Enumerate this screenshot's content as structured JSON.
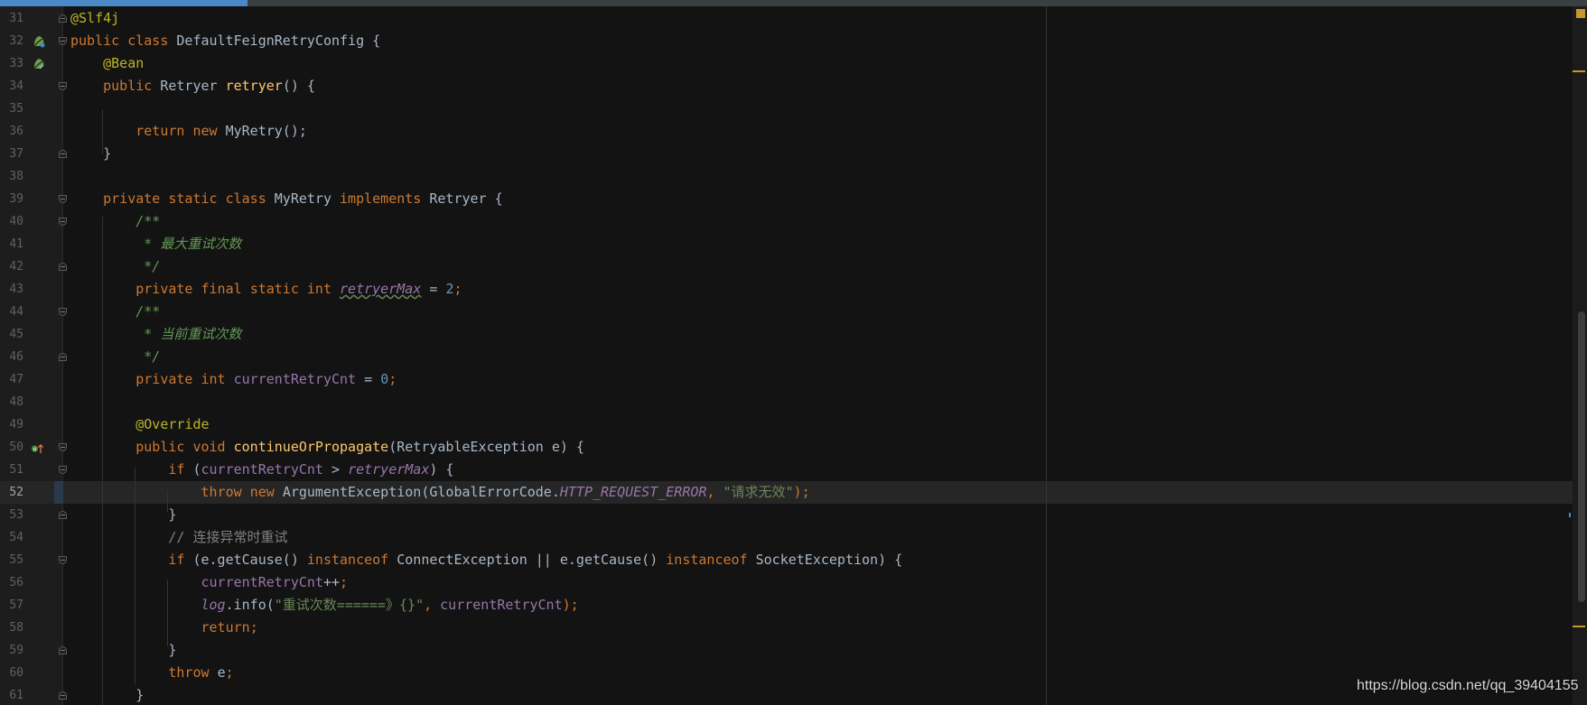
{
  "editor": {
    "scroll_progress": 0.156,
    "current_line": "52",
    "lines": [
      {
        "num": "31",
        "tokens": [
          {
            "t": "@Slf4j",
            "c": "ann"
          }
        ]
      },
      {
        "num": "32",
        "tokens": [
          {
            "t": "public ",
            "c": "kw"
          },
          {
            "t": "class ",
            "c": "kw"
          },
          {
            "t": "DefaultFeignRetryConfig {",
            "c": ""
          }
        ]
      },
      {
        "num": "33",
        "tokens": [
          {
            "t": "    "
          },
          {
            "t": "@Bean",
            "c": "ann"
          }
        ]
      },
      {
        "num": "34",
        "tokens": [
          {
            "t": "    "
          },
          {
            "t": "public ",
            "c": "kw"
          },
          {
            "t": "Retryer ",
            "c": ""
          },
          {
            "t": "retryer",
            "c": "fn"
          },
          {
            "t": "() {",
            "c": ""
          }
        ]
      },
      {
        "num": "35",
        "tokens": []
      },
      {
        "num": "36",
        "tokens": [
          {
            "t": "        "
          },
          {
            "t": "return ",
            "c": "kw"
          },
          {
            "t": "new ",
            "c": "kw"
          },
          {
            "t": "MyRetry();",
            "c": ""
          }
        ]
      },
      {
        "num": "37",
        "tokens": [
          {
            "t": "    }"
          }
        ]
      },
      {
        "num": "38",
        "tokens": []
      },
      {
        "num": "39",
        "tokens": [
          {
            "t": "    "
          },
          {
            "t": "private ",
            "c": "kw"
          },
          {
            "t": "static ",
            "c": "kw"
          },
          {
            "t": "class ",
            "c": "kw"
          },
          {
            "t": "MyRetry ",
            "c": ""
          },
          {
            "t": "implements ",
            "c": "kw"
          },
          {
            "t": "Retryer {",
            "c": ""
          }
        ]
      },
      {
        "num": "40",
        "tokens": [
          {
            "t": "        "
          },
          {
            "t": "/**",
            "c": "cmt"
          }
        ]
      },
      {
        "num": "41",
        "tokens": [
          {
            "t": "         "
          },
          {
            "t": "* 最大重试次数",
            "c": "cmt"
          }
        ]
      },
      {
        "num": "42",
        "tokens": [
          {
            "t": "         "
          },
          {
            "t": "*/",
            "c": "cmt"
          }
        ]
      },
      {
        "num": "43",
        "tokens": [
          {
            "t": "        "
          },
          {
            "t": "private ",
            "c": "kw"
          },
          {
            "t": "final ",
            "c": "kw"
          },
          {
            "t": "static ",
            "c": "kw"
          },
          {
            "t": "int ",
            "c": "kw"
          },
          {
            "t": "retryerMax",
            "c": "st wavy"
          },
          {
            "t": " = ",
            "c": ""
          },
          {
            "t": "2",
            "c": "num"
          },
          {
            "t": ";",
            "c": "kw"
          }
        ]
      },
      {
        "num": "44",
        "tokens": [
          {
            "t": "        "
          },
          {
            "t": "/**",
            "c": "cmt"
          }
        ]
      },
      {
        "num": "45",
        "tokens": [
          {
            "t": "         "
          },
          {
            "t": "* 当前重试次数",
            "c": "cmt"
          }
        ]
      },
      {
        "num": "46",
        "tokens": [
          {
            "t": "         "
          },
          {
            "t": "*/",
            "c": "cmt"
          }
        ]
      },
      {
        "num": "47",
        "tokens": [
          {
            "t": "        "
          },
          {
            "t": "private ",
            "c": "kw"
          },
          {
            "t": "int ",
            "c": "kw"
          },
          {
            "t": "currentRetryCnt",
            "c": "fld"
          },
          {
            "t": " = ",
            "c": ""
          },
          {
            "t": "0",
            "c": "num"
          },
          {
            "t": ";",
            "c": "kw"
          }
        ]
      },
      {
        "num": "48",
        "tokens": []
      },
      {
        "num": "49",
        "tokens": [
          {
            "t": "        "
          },
          {
            "t": "@Override",
            "c": "ann"
          }
        ]
      },
      {
        "num": "50",
        "tokens": [
          {
            "t": "        "
          },
          {
            "t": "public ",
            "c": "kw"
          },
          {
            "t": "void ",
            "c": "kw"
          },
          {
            "t": "continueOrPropagate",
            "c": "fn"
          },
          {
            "t": "(RetryableException e) {",
            "c": ""
          }
        ]
      },
      {
        "num": "51",
        "tokens": [
          {
            "t": "            "
          },
          {
            "t": "if ",
            "c": "kw"
          },
          {
            "t": "(",
            "c": ""
          },
          {
            "t": "currentRetryCnt",
            "c": "fld"
          },
          {
            "t": " > ",
            "c": ""
          },
          {
            "t": "retryerMax",
            "c": "st"
          },
          {
            "t": ") {",
            "c": ""
          }
        ]
      },
      {
        "num": "52",
        "tokens": [
          {
            "t": "                "
          },
          {
            "t": "throw ",
            "c": "kw"
          },
          {
            "t": "new ",
            "c": "kw"
          },
          {
            "t": "ArgumentException(GlobalErrorCode.",
            "c": ""
          },
          {
            "t": "HTTP_REQUEST_ERROR",
            "c": "st"
          },
          {
            "t": ", ",
            "c": "kw"
          },
          {
            "t": "\"请求无效\"",
            "c": "str"
          },
          {
            "t": ");",
            "c": "kw"
          }
        ]
      },
      {
        "num": "53",
        "tokens": [
          {
            "t": "            }"
          }
        ]
      },
      {
        "num": "54",
        "tokens": [
          {
            "t": "            "
          },
          {
            "t": "// 连接异常时重试",
            "c": "lc"
          }
        ]
      },
      {
        "num": "55",
        "tokens": [
          {
            "t": "            "
          },
          {
            "t": "if ",
            "c": "kw"
          },
          {
            "t": "(e.getCause() ",
            "c": ""
          },
          {
            "t": "instanceof ",
            "c": "kw"
          },
          {
            "t": "ConnectException || e.getCause() ",
            "c": ""
          },
          {
            "t": "instanceof ",
            "c": "kw"
          },
          {
            "t": "SocketException) {",
            "c": ""
          }
        ]
      },
      {
        "num": "56",
        "tokens": [
          {
            "t": "                "
          },
          {
            "t": "currentRetryCnt",
            "c": "fld"
          },
          {
            "t": "++",
            "c": ""
          },
          {
            "t": ";",
            "c": "kw"
          }
        ]
      },
      {
        "num": "57",
        "tokens": [
          {
            "t": "                "
          },
          {
            "t": "log",
            "c": "st"
          },
          {
            "t": ".info(",
            "c": ""
          },
          {
            "t": "\"重试次数======》{}\"",
            "c": "str"
          },
          {
            "t": ", ",
            "c": "kw"
          },
          {
            "t": "currentRetryCnt",
            "c": "fld"
          },
          {
            "t": ");",
            "c": "kw"
          }
        ]
      },
      {
        "num": "58",
        "tokens": [
          {
            "t": "                "
          },
          {
            "t": "return",
            "c": "kw"
          },
          {
            "t": ";",
            "c": "kw"
          }
        ]
      },
      {
        "num": "59",
        "tokens": [
          {
            "t": "            }"
          }
        ]
      },
      {
        "num": "60",
        "tokens": [
          {
            "t": "            "
          },
          {
            "t": "throw ",
            "c": "kw"
          },
          {
            "t": "e",
            "c": ""
          },
          {
            "t": ";",
            "c": "kw"
          }
        ]
      },
      {
        "num": "61",
        "tokens": [
          {
            "t": "        }"
          }
        ]
      }
    ]
  },
  "watermark": "https://blog.csdn.net/qq_39404155",
  "colors": {
    "background": "#131313",
    "keyword": "#cc7832",
    "annotation": "#bbb529",
    "method": "#ffc66d",
    "field": "#9876aa",
    "string": "#6a8759",
    "number": "#6897bb",
    "comment": "#629755"
  },
  "icons": {
    "line32": "spring-bean-icon",
    "line33": "spring-bean-icon",
    "line50": "override-method-icon"
  }
}
